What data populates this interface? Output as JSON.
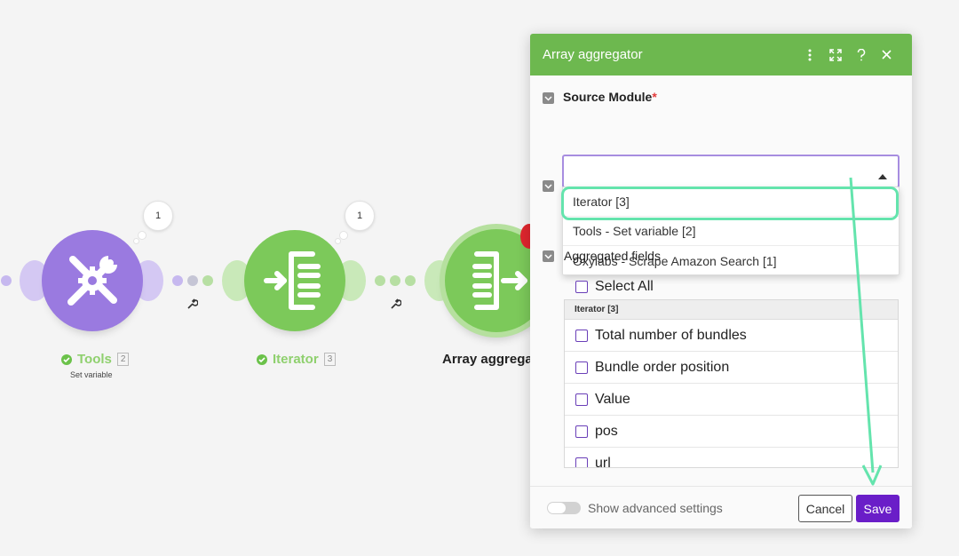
{
  "scenario": {
    "nodes": [
      {
        "name": "Tools",
        "index": "2",
        "subtitle": "Set variable",
        "bubble_count": "1",
        "color": "#9a7ae0",
        "status": "success"
      },
      {
        "name": "Iterator",
        "index": "3",
        "bubble_count": "1",
        "color": "#7cc95a",
        "status": "success"
      },
      {
        "name": "Array aggrega",
        "color": "#7cc95a"
      }
    ]
  },
  "panel": {
    "title": "Array aggregator",
    "header_icons": [
      "more-vertical-icon",
      "expand-icon",
      "help-icon",
      "close-icon"
    ],
    "source_module": {
      "label": "Source Module",
      "required_mark": "*",
      "value": "",
      "options": [
        "Iterator [3]",
        "Tools - Set variable [2]",
        "Oxylabs - Scrape Amazon Search [1]"
      ],
      "highlighted_option": "Iterator [3]"
    },
    "aggregated_fields": {
      "label": "Aggregated fields",
      "select_all_label": "Select All",
      "group_header": "Iterator [3]",
      "fields": [
        "Total number of bundles",
        "Bundle order position",
        "Value",
        "pos",
        "url"
      ]
    },
    "footer": {
      "advanced_toggle_label": "Show advanced settings",
      "advanced_toggle_on": false,
      "cancel_label": "Cancel",
      "save_label": "Save"
    }
  },
  "colors": {
    "header_green": "#6db84f",
    "tools_purple": "#9a7ae0",
    "save_purple": "#6a1ec8",
    "highlight_mint": "#64e4ad",
    "select_border": "#a78de0"
  }
}
